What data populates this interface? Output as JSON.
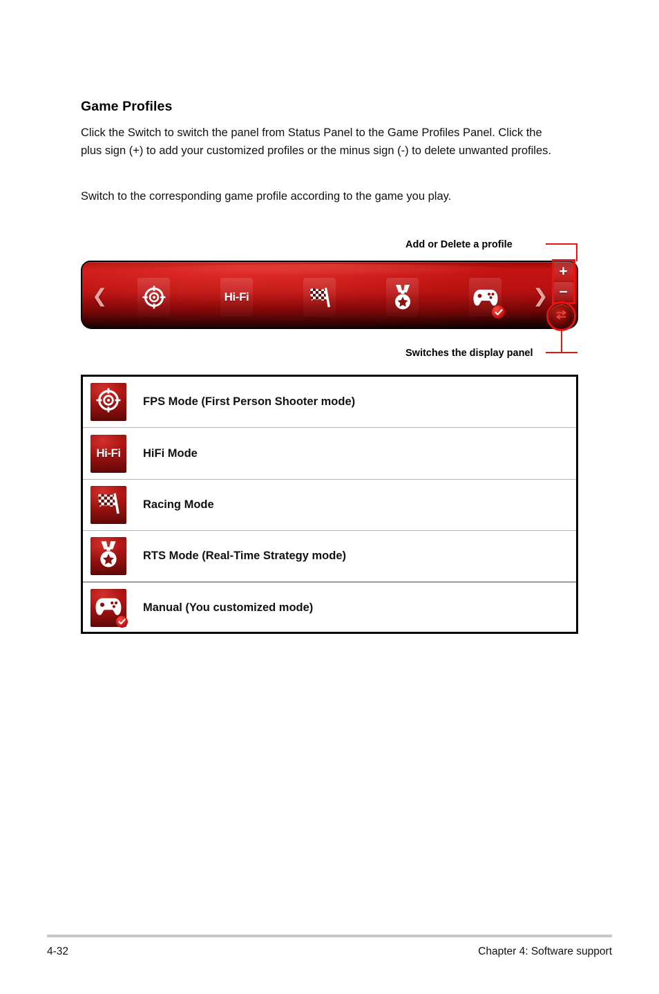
{
  "document": {
    "heading": "Game Profiles",
    "paragraphs": [
      "Click the Switch to switch the panel from Status Panel to the Game Profiles Panel. Click the plus sign (+) to add your customized profiles or the minus sign (-) to delete unwanted profiles.",
      "Switch to the corresponding game profile according to the game you play."
    ]
  },
  "panel": {
    "nav_prev_glyph": "❮",
    "nav_next_glyph": "❯",
    "tiles": [
      {
        "icon": "crosshair-target-icon",
        "label": "FPS",
        "selected": false
      },
      {
        "icon": "hifi-text-icon",
        "label": "Hi-Fi",
        "selected": false
      },
      {
        "icon": "checkered-flag-icon",
        "label": "Racing",
        "selected": false
      },
      {
        "icon": "medal-star-icon",
        "label": "RTS",
        "selected": false
      },
      {
        "icon": "gamepad-icon",
        "label": "Manual",
        "selected": true
      }
    ],
    "add_button_glyph": "+",
    "delete_button_glyph": "−",
    "switch_button_icon": "swap-arrows-icon"
  },
  "callouts": {
    "add_delete": "Add or Delete a profile",
    "switch_panel": "Switches the display panel"
  },
  "modes": [
    {
      "icon": "crosshair-target-icon",
      "label": "FPS Mode (First Person Shooter mode)"
    },
    {
      "icon": "hifi-text-icon",
      "label": "HiFi Mode"
    },
    {
      "icon": "checkered-flag-icon",
      "label": "Racing Mode"
    },
    {
      "icon": "medal-star-icon",
      "label": "RTS Mode (Real-Time Strategy mode)"
    },
    {
      "icon": "gamepad-icon",
      "label": "Manual (You customized mode)"
    }
  ],
  "hifi_glyph_text": "Hi-Fi",
  "footer": {
    "page_number": "4-32",
    "chapter": "Chapter 4: Software support"
  },
  "colors": {
    "panel_red": "#b21010",
    "highlight_red": "#e8120e",
    "icon_tile_red": "#a31210",
    "rule_gray": "#c8c8c8"
  }
}
